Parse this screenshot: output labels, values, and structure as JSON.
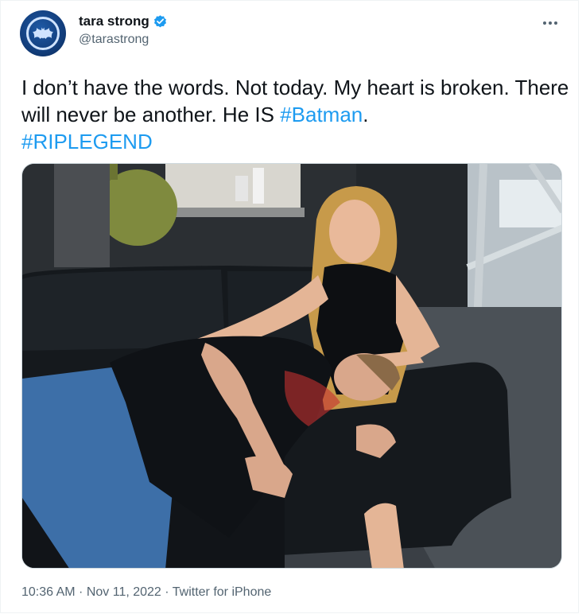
{
  "author": {
    "display_name": "tara strong",
    "handle": "@tarastrong",
    "verified": true,
    "avatar_icon": "batman-logo-icon"
  },
  "tweet": {
    "text_part1": "I don’t have the words. Not today. My heart is broken. There will never be another. He IS ",
    "hashtag1": "#Batman",
    "text_part2": ".",
    "hashtag2": "#RIPLEGEND"
  },
  "meta": {
    "time": "10:36 AM",
    "separator": " · ",
    "date": "Nov 11, 2022",
    "source": "Twitter for iPhone"
  },
  "colors": {
    "link": "#1d9bf0",
    "secondary_text": "#536471",
    "primary_text": "#0f1419"
  }
}
